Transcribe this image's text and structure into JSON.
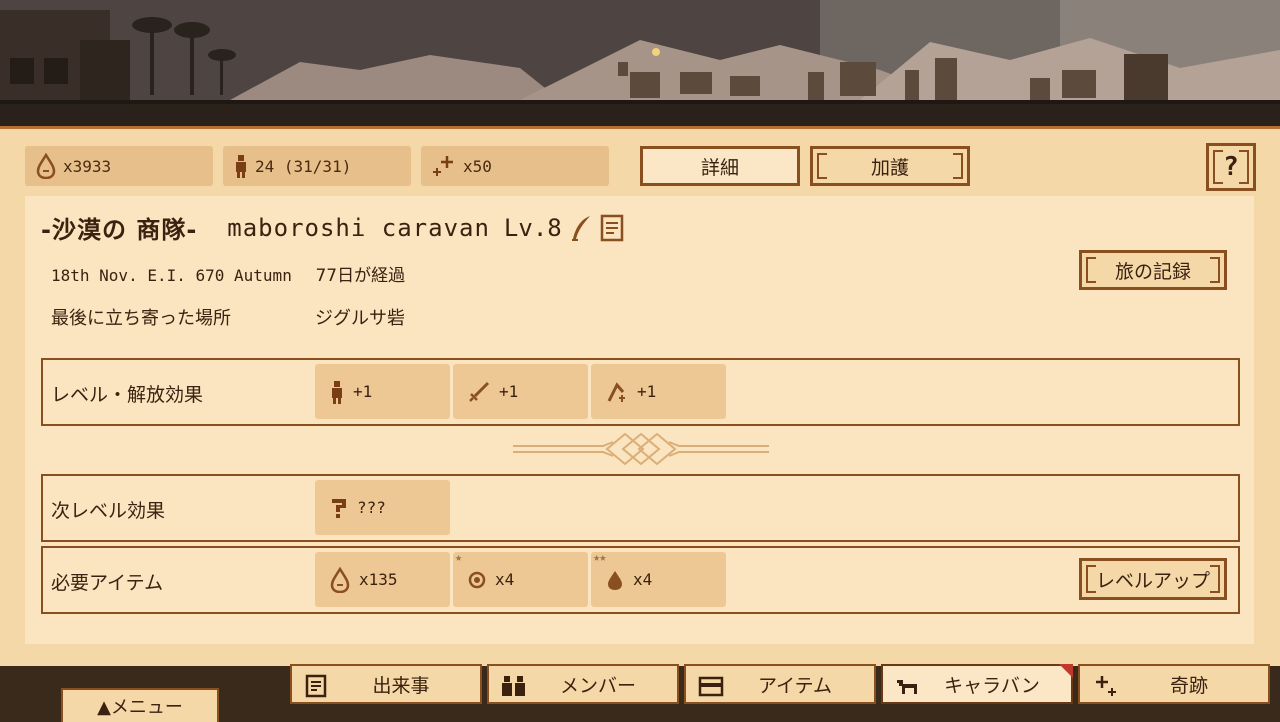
{
  "resources": {
    "sand": "x3933",
    "members": "24 (31/31)",
    "sparkle": "x50"
  },
  "header_buttons": {
    "details": "詳細",
    "blessing": "加護",
    "help": "?"
  },
  "caravan": {
    "name_jp": "-沙漠の 商隊-",
    "name_en": "maboroshi caravan",
    "level": "Lv.8",
    "date": "18th Nov. E.I. 670 Autumn",
    "elapsed": "77日が経過",
    "last_place_label": "最後に立ち寄った場所",
    "last_place": "ジグルサ砦",
    "journal_button": "旅の記録"
  },
  "level_effects": {
    "label": "レベル・解放効果",
    "items": [
      {
        "icon": "member-icon",
        "value": "+1"
      },
      {
        "icon": "sword-icon",
        "value": "+1"
      },
      {
        "icon": "skill-icon",
        "value": "+1"
      }
    ]
  },
  "next_level": {
    "label": "次レベル効果",
    "items": [
      {
        "icon": "question-icon",
        "value": "???"
      }
    ]
  },
  "required_items": {
    "label": "必要アイテム",
    "items": [
      {
        "icon": "sand-icon",
        "value": "x135",
        "stars": ""
      },
      {
        "icon": "orb-icon",
        "value": "x4",
        "stars": "★"
      },
      {
        "icon": "drop-icon",
        "value": "x4",
        "stars": "★★"
      }
    ],
    "levelup_button": "レベルアップ"
  },
  "tabs": [
    {
      "label": "出来事",
      "icon": "document-icon"
    },
    {
      "label": "メンバー",
      "icon": "members-icon"
    },
    {
      "label": "アイテム",
      "icon": "chest-icon"
    },
    {
      "label": "キャラバン",
      "icon": "camel-icon",
      "active": true
    },
    {
      "label": "奇跡",
      "icon": "sparkle-icon"
    }
  ],
  "menu_button": "▲メニュー",
  "colors": {
    "panel": "#f5d8a8",
    "border": "#8a4f1f",
    "chip": "#edc894",
    "notification": "#c0392b"
  }
}
